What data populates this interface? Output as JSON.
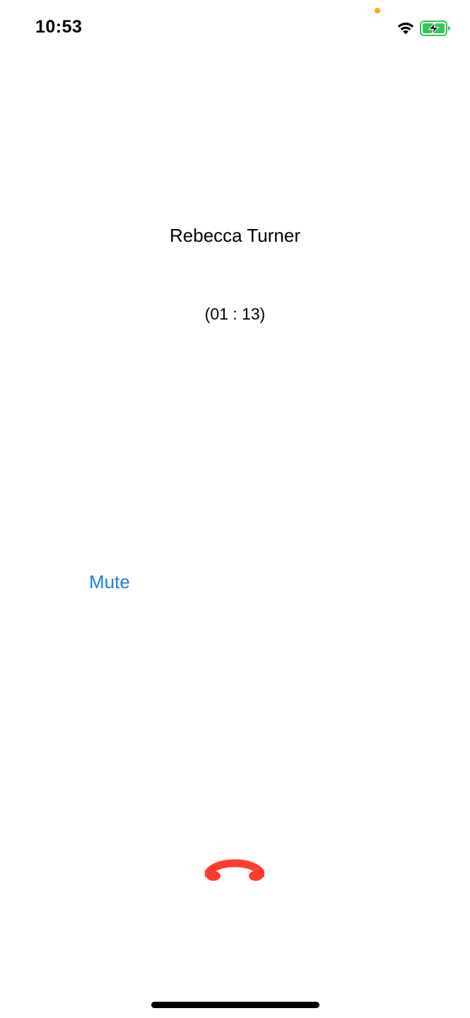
{
  "status_bar": {
    "time": "10:53",
    "privacy_indicator_color": "#F6A623",
    "wifi_icon": "wifi-icon",
    "battery_icon": "battery-charging-icon",
    "battery_color": "#34C759"
  },
  "call": {
    "contact_name": "Rebecca Turner",
    "duration": "(01 : 13)"
  },
  "controls": {
    "mute_label": "Mute",
    "mute_color": "#1A7FE2",
    "end_call_icon": "phone-hangup-icon",
    "end_call_color": "#FF3B30"
  }
}
